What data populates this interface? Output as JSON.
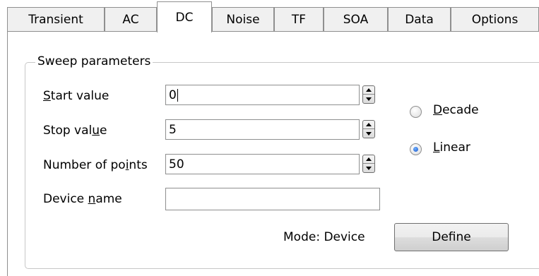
{
  "tabs": [
    {
      "label": "Transient"
    },
    {
      "label": "AC"
    },
    {
      "label": "DC"
    },
    {
      "label": "Noise"
    },
    {
      "label": "TF"
    },
    {
      "label": "SOA"
    },
    {
      "label": "Data"
    },
    {
      "label": "Options"
    }
  ],
  "active_tab": "DC",
  "sweep": {
    "group_title": "Sweep parameters",
    "start": {
      "label_pre": "",
      "label_u": "S",
      "label_post": "tart value",
      "value": "0"
    },
    "stop": {
      "label_pre": "Stop val",
      "label_u": "u",
      "label_post": "e",
      "value": "5"
    },
    "points": {
      "label_pre": "Number of po",
      "label_u": "i",
      "label_post": "nts",
      "value": "50"
    },
    "device": {
      "label_pre": "Device ",
      "label_u": "n",
      "label_post": "ame",
      "value": ""
    }
  },
  "scale": {
    "decade": {
      "label_u": "D",
      "label_post": "ecade",
      "selected": false
    },
    "linear": {
      "label_u": "L",
      "label_post": "inear",
      "selected": true
    }
  },
  "mode_text": "Mode: Device",
  "define_label": "Define"
}
